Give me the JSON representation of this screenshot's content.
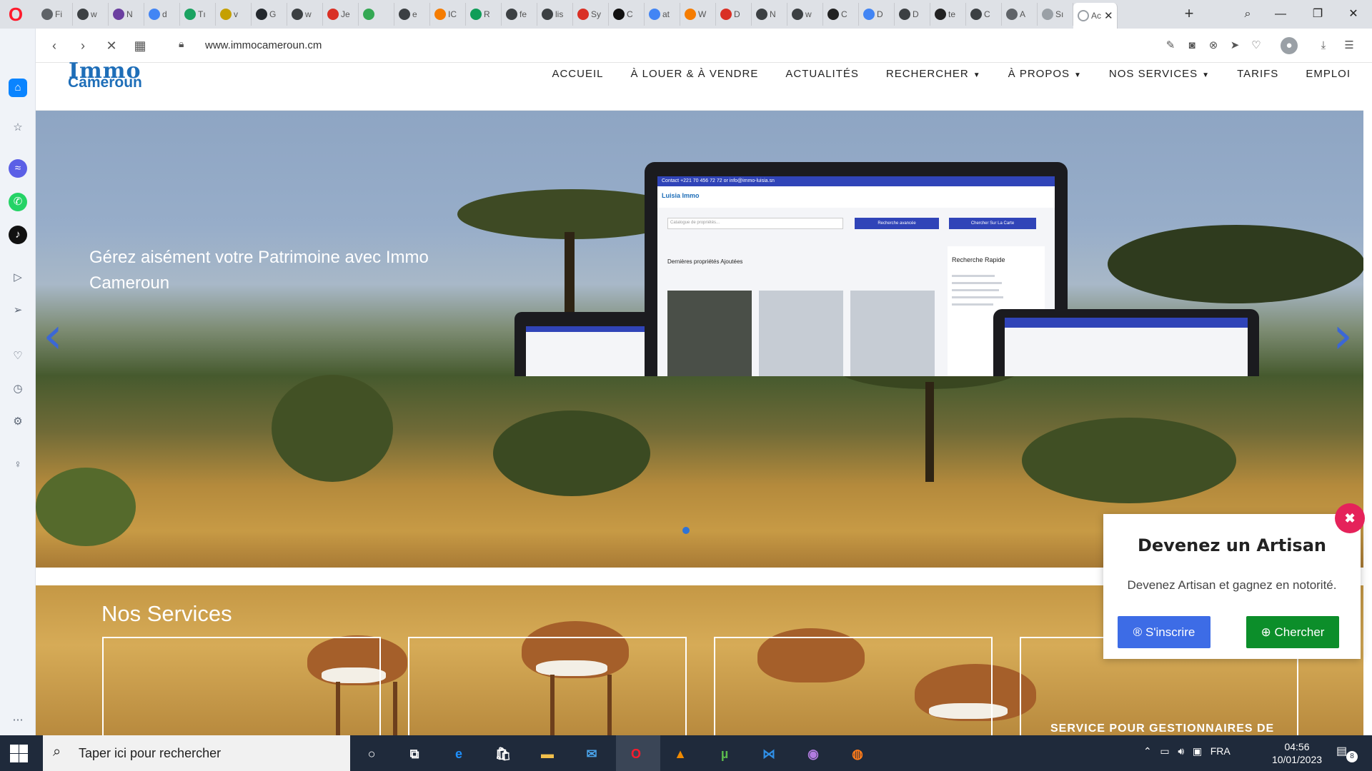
{
  "browser": {
    "tabs": [
      {
        "label": "Fi",
        "color": "#5f6368"
      },
      {
        "label": "w",
        "color": "#3c4043"
      },
      {
        "label": "N",
        "color": "#6b3fa0"
      },
      {
        "label": "d",
        "color": "#4285f4"
      },
      {
        "label": "Tı",
        "color": "#1aa260"
      },
      {
        "label": "v",
        "color": "#c5a000"
      },
      {
        "label": "G",
        "color": "#24292e"
      },
      {
        "label": "w",
        "color": "#3c4043"
      },
      {
        "label": "Je",
        "color": "#d93025"
      },
      {
        "label": "",
        "color": "#34a853"
      },
      {
        "label": "e",
        "color": "#3c4043"
      },
      {
        "label": "IC",
        "color": "#f57c00"
      },
      {
        "label": "R",
        "color": "#0f9d58"
      },
      {
        "label": "fe",
        "color": "#3c4043"
      },
      {
        "label": "lis",
        "color": "#3c4043"
      },
      {
        "label": "Sy",
        "color": "#d93025"
      },
      {
        "label": "C",
        "color": "#111111"
      },
      {
        "label": "at",
        "color": "#4285f4"
      },
      {
        "label": "W",
        "color": "#f57c00"
      },
      {
        "label": "D",
        "color": "#d93025"
      },
      {
        "label": "N",
        "color": "#3c4043"
      },
      {
        "label": "w",
        "color": "#3c4043"
      },
      {
        "label": "C",
        "color": "#222222"
      },
      {
        "label": "D",
        "color": "#4285f4"
      },
      {
        "label": "D",
        "color": "#3c4043"
      },
      {
        "label": "te",
        "color": "#222222"
      },
      {
        "label": "C",
        "color": "#3c4043"
      },
      {
        "label": "A",
        "color": "#5f6368"
      },
      {
        "label": "Sı",
        "color": "#9aa0a6"
      }
    ],
    "active_tab": {
      "label": "Ac",
      "close": "✕"
    },
    "new_tab": "+",
    "url": "www.immocameroun.cm",
    "window_controls": {
      "search": "⌕",
      "minimize": "—",
      "restore": "❐",
      "close": "✕"
    },
    "nav": {
      "back": "‹",
      "forward": "›",
      "stop": "✕",
      "grid": "▦"
    }
  },
  "site": {
    "logo": {
      "top": "Immo",
      "bottom": "Cameroun"
    },
    "menu": [
      {
        "label": "ACCUEIL",
        "dropdown": false
      },
      {
        "label": "À LOUER & À VENDRE",
        "dropdown": false
      },
      {
        "label": "ACTUALITÉS",
        "dropdown": false
      },
      {
        "label": "RECHERCHER",
        "dropdown": true
      },
      {
        "label": "À PROPOS",
        "dropdown": true
      },
      {
        "label": "NOS SERVICES",
        "dropdown": true
      },
      {
        "label": "TARIFS",
        "dropdown": false
      },
      {
        "label": "EMPLOI",
        "dropdown": false
      }
    ],
    "hero": {
      "text": "Gérez aisément votre Patrimoine avec Immo Cameroun",
      "prev": "‹",
      "next": "›",
      "mockup": {
        "contact": "Contact +221 70 456 72 72 or info@immo-luisia.sn",
        "logo": "Luisia Immo",
        "search_placeholder": "Catalogue de propriétés...",
        "btn_advanced": "Recherche avancée",
        "btn_map": "Chercher Sur La Carte",
        "latest": "Dernières propriétés Ajoutées",
        "quick": "Recherche Rapide"
      }
    },
    "services": {
      "title": "Nos Services",
      "partial_caption": "SERVICE POUR GESTIONNAIRES DE"
    },
    "popup": {
      "title": "Devenez un Artisan",
      "text": "Devenez Artisan et gagnez en notorité.",
      "register": "S'inscrire",
      "search": "Chercher",
      "close": "✖"
    }
  },
  "taskbar": {
    "search_placeholder": "Taper ici pour rechercher",
    "language": "FRA",
    "time": "04:56",
    "date": "10/01/2023",
    "notifications": "8"
  }
}
